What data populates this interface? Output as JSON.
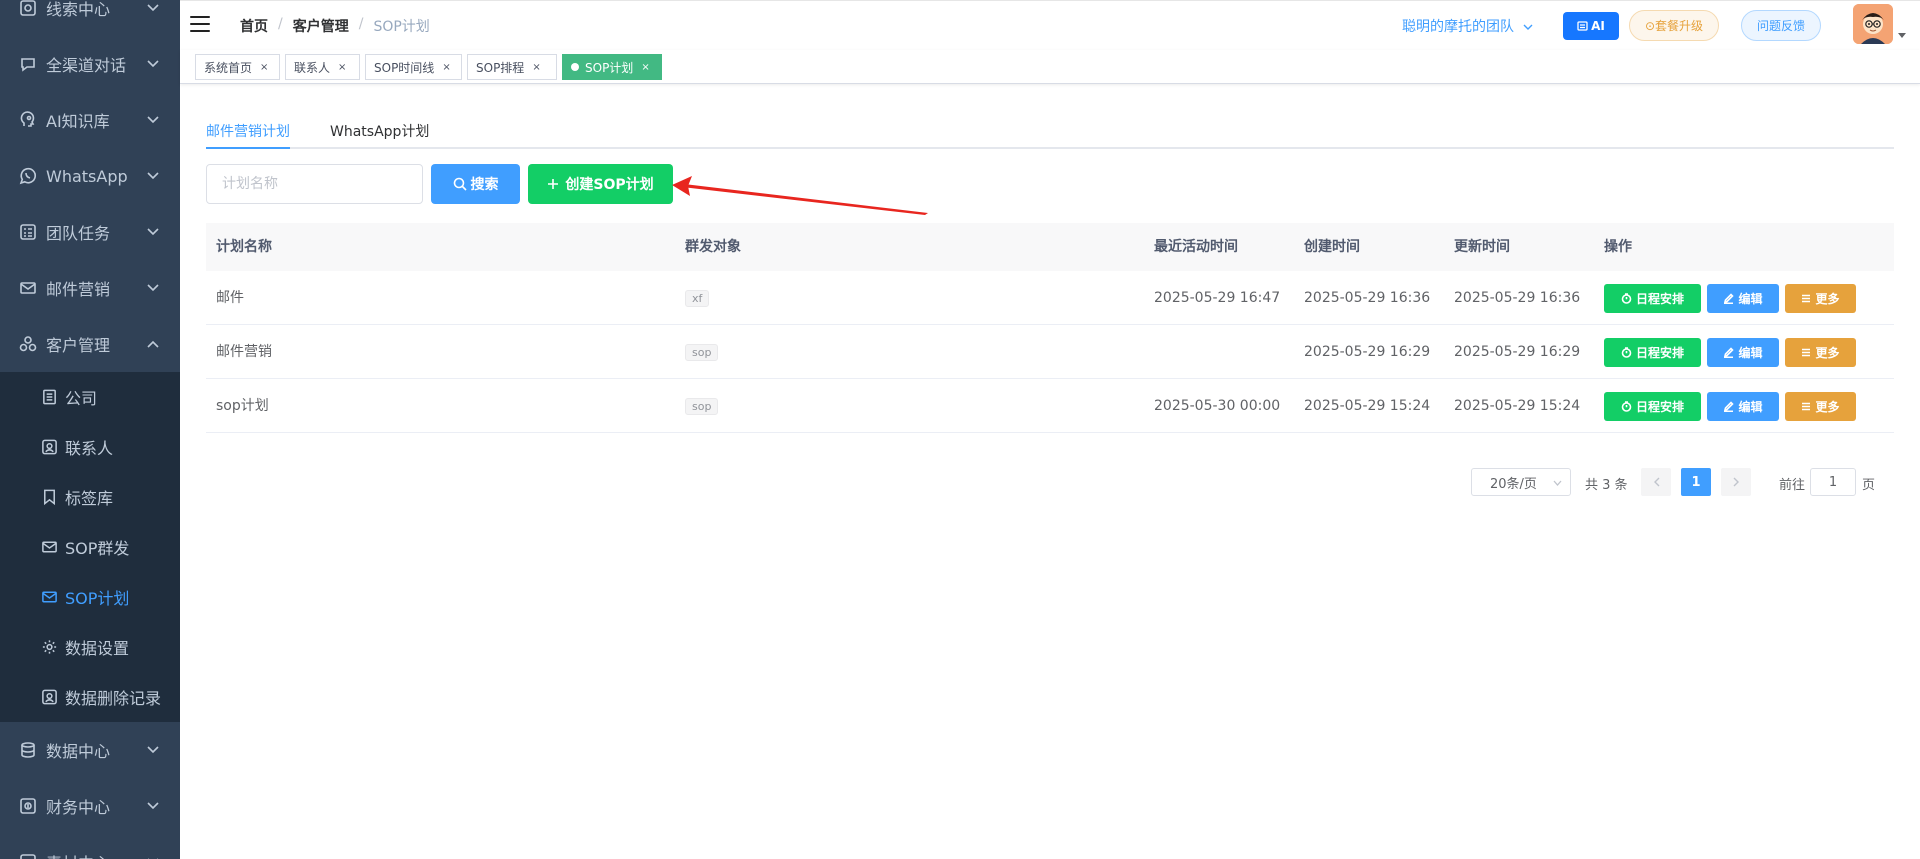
{
  "sidebar": {
    "items": [
      {
        "label": "线索中心",
        "icon": "clue-icon"
      },
      {
        "label": "全渠道对话",
        "icon": "chat-icon"
      },
      {
        "label": "AI知识库",
        "icon": "brain-icon"
      },
      {
        "label": "WhatsApp",
        "icon": "whatsapp-icon"
      },
      {
        "label": "团队任务",
        "icon": "task-list-icon"
      },
      {
        "label": "邮件营销",
        "icon": "mail-send-icon"
      },
      {
        "label": "客户管理",
        "icon": "customer-icon"
      },
      {
        "label": "数据中心",
        "icon": "database-icon"
      },
      {
        "label": "财务中心",
        "icon": "finance-icon"
      },
      {
        "label": "素材中心",
        "icon": "material-icon"
      }
    ],
    "sub_items": [
      {
        "label": "公司",
        "icon": "company-icon"
      },
      {
        "label": "联系人",
        "icon": "contact-icon"
      },
      {
        "label": "标签库",
        "icon": "bookmark-icon"
      },
      {
        "label": "SOP群发",
        "icon": "mail-icon"
      },
      {
        "label": "SOP计划",
        "icon": "mail-icon"
      },
      {
        "label": "数据设置",
        "icon": "gear-icon"
      },
      {
        "label": "数据删除记录",
        "icon": "record-icon"
      }
    ]
  },
  "navbar": {
    "breadcrumb": [
      "首页",
      "客户管理",
      "SOP计划"
    ],
    "team": "聪明的摩托的团队",
    "ai_label": "AI",
    "upgrade_label": "⊙套餐升级",
    "feedback_label": "问题反馈"
  },
  "tags": [
    {
      "label": "系统首页"
    },
    {
      "label": "联系人"
    },
    {
      "label": "SOP时间线"
    },
    {
      "label": "SOP排程"
    },
    {
      "label": "SOP计划"
    }
  ],
  "tabs": [
    "邮件营销计划",
    "WhatsApp计划"
  ],
  "search": {
    "placeholder": "计划名称",
    "search_label": "搜索",
    "create_label": "创建SOP计划"
  },
  "table": {
    "headers": [
      "计划名称",
      "群发对象",
      "最近活动时间",
      "创建时间",
      "更新时间",
      "操作"
    ],
    "rows": [
      {
        "name": "邮件",
        "target": "xf",
        "last_active": "2025-05-29 16:47",
        "created": "2025-05-29 16:36",
        "updated": "2025-05-29 16:36"
      },
      {
        "name": "邮件营销",
        "target": "sop",
        "last_active": "",
        "created": "2025-05-29 16:29",
        "updated": "2025-05-29 16:29"
      },
      {
        "name": "sop计划",
        "target": "sop",
        "last_active": "2025-05-30 00:00",
        "created": "2025-05-29 15:24",
        "updated": "2025-05-29 15:24"
      }
    ],
    "actions": {
      "schedule": "日程安排",
      "edit": "编辑",
      "more": "更多"
    }
  },
  "pagination": {
    "page_size": "20条/页",
    "total": "共 3 条",
    "current_page": "1",
    "goto_label": "前往",
    "goto_value": "1",
    "page_suffix": "页"
  },
  "colors": {
    "sidebar_bg": "#304156",
    "primary": "#409eff",
    "success": "#13ce66",
    "warning": "#e6a23c",
    "active_tag": "#42b983",
    "annotation_arrow": "#e8261f"
  }
}
